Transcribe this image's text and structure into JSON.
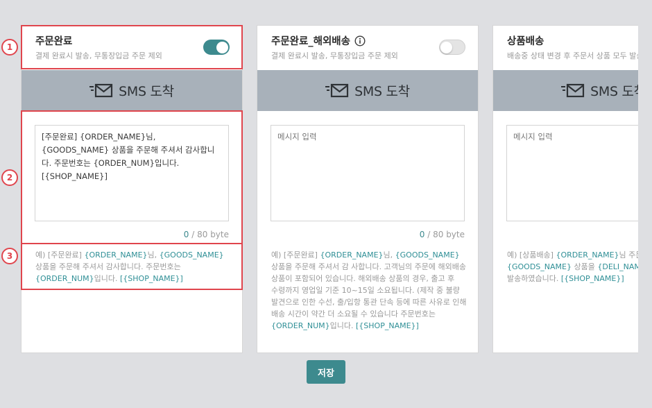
{
  "cards": [
    {
      "title": "주문완료",
      "description": "결제 완료시 발송, 무통장입금 주문 제외",
      "toggle_on": true,
      "banner_label": "SMS 도착",
      "message": "[주문완료] {ORDER_NAME}님, {GOODS_NAME} 상품을 주문해 주셔서 감사합니다. 주문번호는 {ORDER_NUM}입니다. [{SHOP_NAME}]",
      "byte_current": "0",
      "byte_limit": " / 80 byte",
      "example": [
        {
          "t": "예) [주문완료] "
        },
        {
          "t": "{ORDER_NAME}",
          "v": true
        },
        {
          "t": "님, "
        },
        {
          "t": "{GOODS_NAME}",
          "v": true
        },
        {
          "t": " 상품을 주문해 주셔서 감사합니다. 주문번호는 "
        },
        {
          "t": "{ORDER_NUM}",
          "v": true
        },
        {
          "t": "입니다. "
        },
        {
          "t": "[{SHOP_NAME}]",
          "v": true
        }
      ]
    },
    {
      "title": "주문완료_해외배송",
      "description": "결제 완료시 발송, 무통장입금 주문 제외",
      "toggle_on": false,
      "banner_label": "SMS 도착",
      "message": "메시지 입력",
      "byte_current": "0",
      "byte_limit": " / 80 byte",
      "example": [
        {
          "t": "예) [주문완료] "
        },
        {
          "t": "{ORDER_NAME}",
          "v": true
        },
        {
          "t": "님, "
        },
        {
          "t": "{GOODS_NAME}",
          "v": true
        },
        {
          "t": " 상품을 주문해 주셔서 감 사합니다. 고객님의 주문에 해외배송 상품이 포함되어 있습니다. 해외배송 상품의 경우, 출고 후 수령까지 영업일 기준 10~15일 소요됩니다. (제작 중 불량 발견으로 인한 수선, 출/입항 통관 단속 등에 따른 사유로 인해 배송 시간이 약간 더 소요될 수 있습니다 주문번호는 "
        },
        {
          "t": "{ORDER_NUM}",
          "v": true
        },
        {
          "t": "입니다. "
        },
        {
          "t": "[{SHOP_NAME}]",
          "v": true
        }
      ]
    },
    {
      "title": "상품배송",
      "description": "배송중 상태 변경 후 주문서 상품 모두 발송",
      "banner_label": "SMS 도착",
      "message": "메시지 입력",
      "example": [
        {
          "t": "예) [상품배송] "
        },
        {
          "t": "{ORDER_NAME}",
          "v": true
        },
        {
          "t": "님 주문하신 "
        },
        {
          "t": "{GOODS_NAME}",
          "v": true
        },
        {
          "t": " 상품을 "
        },
        {
          "t": "{DELI_NAME}",
          "v": true
        },
        {
          "t": " 로 발송하였습니다. "
        },
        {
          "t": "[{SHOP_NAME}]",
          "v": true
        }
      ]
    }
  ],
  "badges": [
    "1",
    "2",
    "3"
  ],
  "save_label": "저장",
  "colors": {
    "accent": "#3d8a8e",
    "highlight": "#e0454d",
    "banner": "#a8b1ba",
    "variable_text": "#2f8f96"
  }
}
